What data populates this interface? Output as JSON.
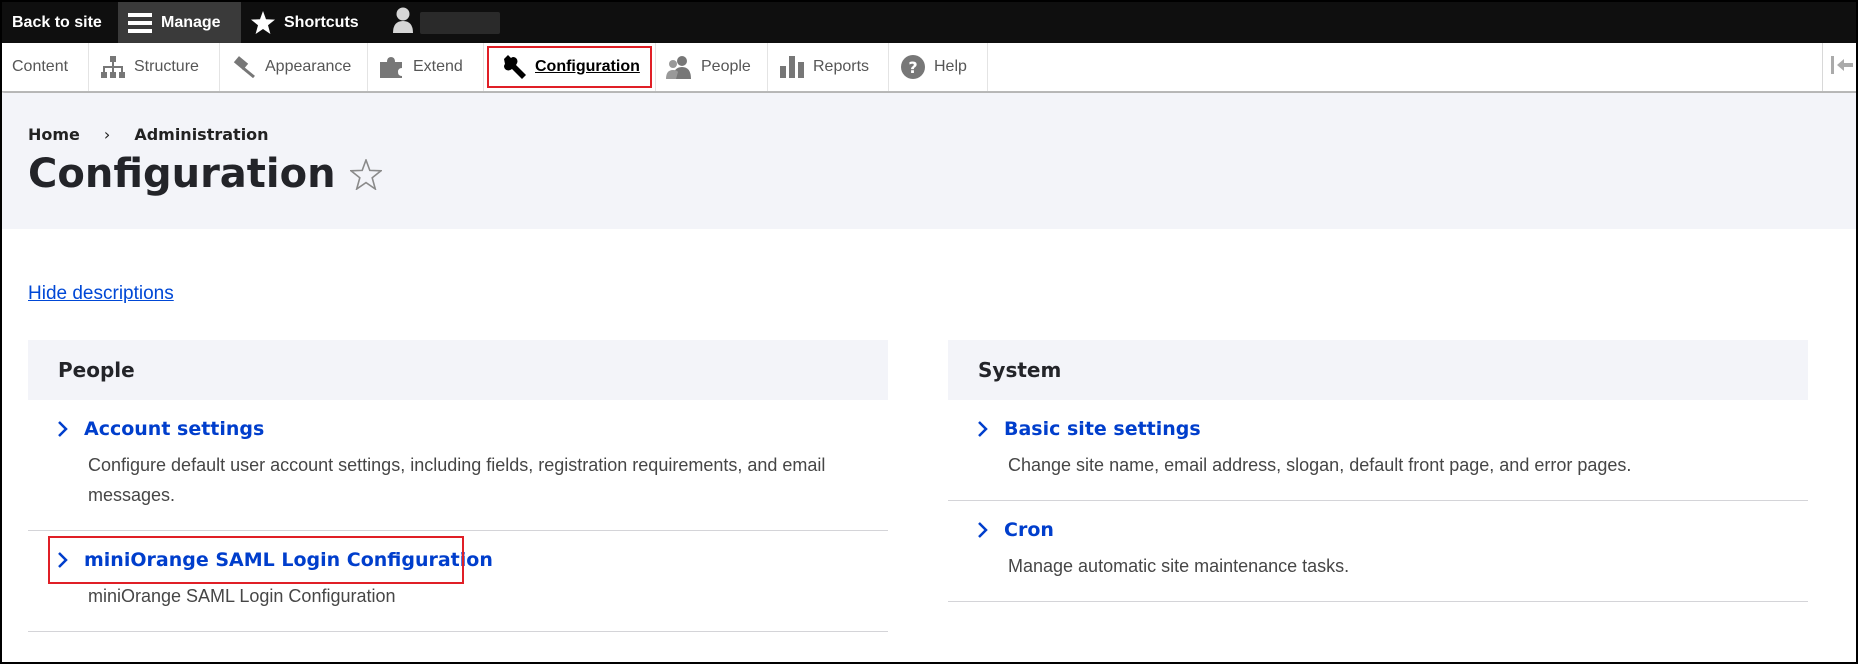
{
  "toolbar": {
    "back_label": "Back to site",
    "manage_label": "Manage",
    "shortcuts_label": "Shortcuts",
    "icons": {
      "manage": "hamburger-icon",
      "shortcuts": "star-icon",
      "user": "user-icon"
    }
  },
  "tray": {
    "items": [
      {
        "label": "Content",
        "icon": ""
      },
      {
        "label": "Structure",
        "icon": "sitemap-icon"
      },
      {
        "label": "Appearance",
        "icon": "paint-icon"
      },
      {
        "label": "Extend",
        "icon": "puzzle-icon"
      },
      {
        "label": "Configuration",
        "icon": "wrench-icon",
        "active": true
      },
      {
        "label": "People",
        "icon": "people-icon"
      },
      {
        "label": "Reports",
        "icon": "bar-chart-icon"
      },
      {
        "label": "Help",
        "icon": "help-icon"
      }
    ]
  },
  "breadcrumb": {
    "home": "Home",
    "separator": "›",
    "admin": "Administration"
  },
  "page": {
    "title": "Configuration",
    "hide_descriptions": "Hide descriptions"
  },
  "panels": {
    "people": {
      "heading": "People",
      "items": [
        {
          "title": "Account settings",
          "description": "Configure default user account settings, including fields, registration requirements, and email messages."
        },
        {
          "title": "miniOrange SAML Login Configuration",
          "description": "miniOrange SAML Login Configuration"
        }
      ]
    },
    "system": {
      "heading": "System",
      "items": [
        {
          "title": "Basic site settings",
          "description": "Change site name, email address, slogan, default front page, and error pages."
        },
        {
          "title": "Cron",
          "description": "Manage automatic site maintenance tasks."
        }
      ]
    }
  },
  "colors": {
    "link": "#003ecc",
    "toolbar": "#0f0f0f",
    "highlight": "#e01f26",
    "header_bg": "#f3f4f9"
  }
}
